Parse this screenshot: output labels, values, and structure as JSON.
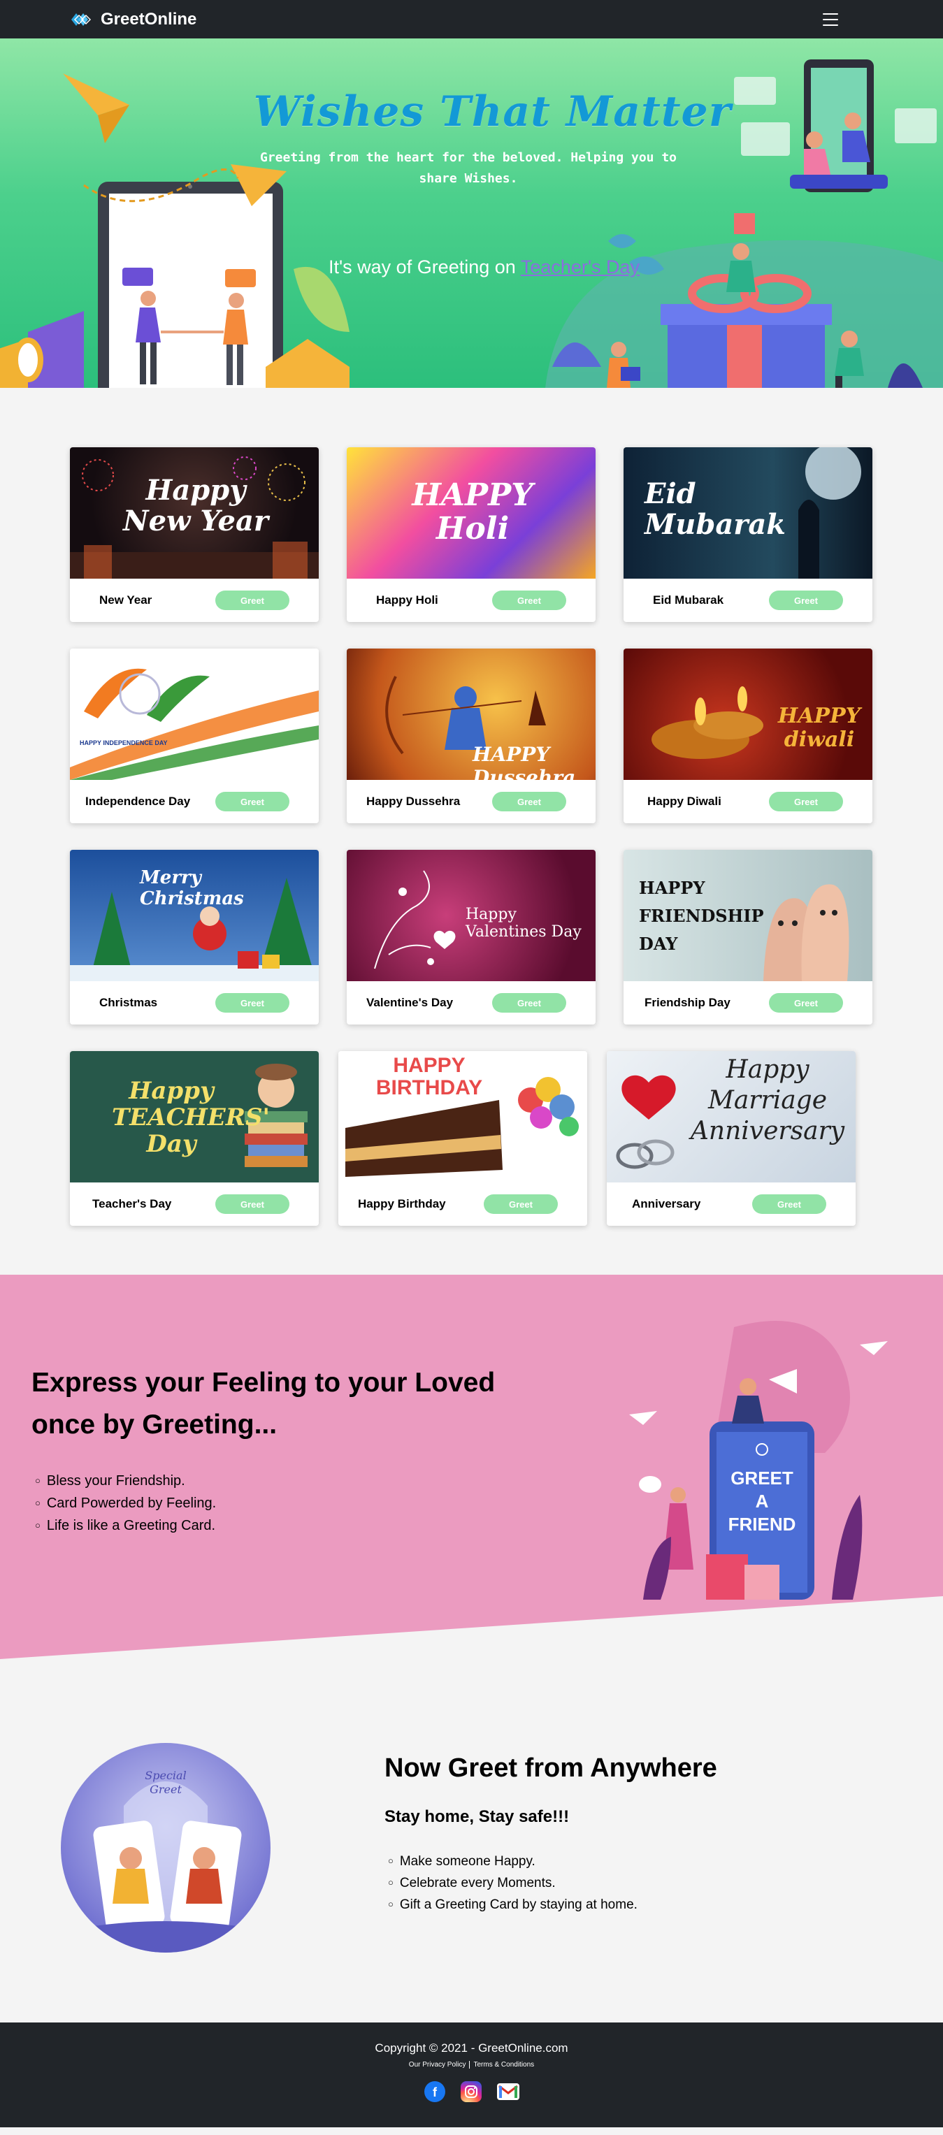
{
  "nav": {
    "brand": "GreetOnline"
  },
  "hero": {
    "title": "Wishes That Matter",
    "subtitle": "Greeting from the heart for the beloved. Helping you to share Wishes.",
    "greet_prefix": "It's way of Greeting on ",
    "greet_occasion": "Teacher's Day"
  },
  "cards": [
    {
      "title": "New Year",
      "button": "Greet",
      "image_text": "Happy New Year"
    },
    {
      "title": "Happy Holi",
      "button": "Greet",
      "image_text": "HAPPY Holi"
    },
    {
      "title": "Eid Mubarak",
      "button": "Greet",
      "image_text": "Eid Mubarak"
    },
    {
      "title": "Independence Day",
      "button": "Greet",
      "image_text": "HAPPY INDEPENDENCE DAY"
    },
    {
      "title": "Happy Dussehra",
      "button": "Greet",
      "image_text": "HAPPY Dussehra"
    },
    {
      "title": "Happy Diwali",
      "button": "Greet",
      "image_text": "HAPPY diwali"
    },
    {
      "title": "Christmas",
      "button": "Greet",
      "image_text": "Merry Christmas"
    },
    {
      "title": "Valentine's Day",
      "button": "Greet",
      "image_text": "Happy Valentines Day"
    },
    {
      "title": "Friendship Day",
      "button": "Greet",
      "image_text": "HAPPY FRIENDSHIP DAY"
    },
    {
      "title": "Teacher's Day",
      "button": "Greet",
      "image_text": "Happy TEACHERS' Day"
    },
    {
      "title": "Happy Birthday",
      "button": "Greet",
      "image_text": "HAPPY BIRTHDAY"
    },
    {
      "title": "Anniversary",
      "button": "Greet",
      "image_text": "Happy Marriage Anniversary"
    }
  ],
  "express": {
    "title": "Express your Feeling to your Loved once by Greeting...",
    "items": [
      "Bless your Friendship.",
      "Card Powerded by Feeling.",
      "Life is like a Greeting Card."
    ],
    "art_text": "GREET A FRIEND"
  },
  "anywhere": {
    "title": "Now Greet from Anywhere",
    "subtitle": "Stay home, Stay safe!!!",
    "items": [
      "Make someone Happy.",
      "Celebrate every Moments.",
      "Gift a Greeting Card by staying at home."
    ],
    "art_text": "Special Greet"
  },
  "footer": {
    "copyright": "Copyright © 2021 - GreetOnline.com",
    "privacy": "Our Privacy Policy",
    "terms": "Terms & Conditions",
    "socials": [
      "facebook-icon",
      "instagram-icon",
      "gmail-icon"
    ]
  },
  "colors": {
    "nav_bg": "#212529",
    "hero_title": "#1399d6",
    "greet_btn": "#91e3a6",
    "express_bg": "#eb9bc0"
  }
}
